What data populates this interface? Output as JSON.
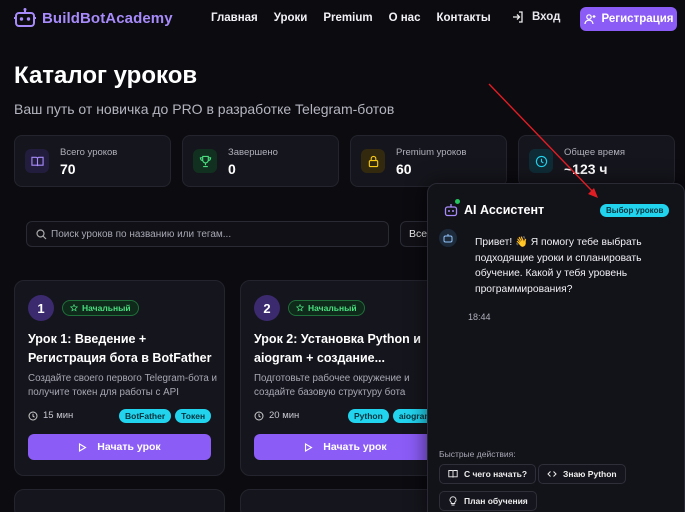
{
  "brand": {
    "name": "BuildBotAcademy",
    "accent": "#8b5cf6"
  },
  "nav": {
    "items": [
      "Главная",
      "Уроки",
      "Premium",
      "О нас",
      "Контакты"
    ],
    "login": "Вход",
    "register": "Регистрация"
  },
  "hero": {
    "title": "Каталог уроков",
    "subtitle": "Ваш путь от новичка до PRO в разработке Telegram-ботов"
  },
  "stats": [
    {
      "label": "Всего уроков",
      "value": "70",
      "icon": "book-icon"
    },
    {
      "label": "Завершено",
      "value": "0",
      "icon": "trophy-icon"
    },
    {
      "label": "Premium уроков",
      "value": "60",
      "icon": "lock-icon"
    },
    {
      "label": "Общее время",
      "value": "~123 ч",
      "icon": "clock-icon"
    }
  ],
  "search": {
    "placeholder": "Поиск уроков по названию или тегам...",
    "filter_value": "Все"
  },
  "lessons": [
    {
      "number": "1",
      "level": "Начальный",
      "title": "Урок 1: Введение + Регистрация бота в BotFather",
      "description": "Создайте своего первого Telegram-бота и получите токен для работы с API",
      "duration": "15 мин",
      "tags": [
        "BotFather",
        "Токен"
      ],
      "cta": "Начать урок"
    },
    {
      "number": "2",
      "level": "Начальный",
      "title": "Урок 2: Установка Python и aiogram + создание...",
      "description": "Подготовьте рабочее окружение и создайте базовую структуру бота",
      "duration": "20 мин",
      "tags": [
        "Python",
        "aiogram"
      ],
      "cta": "Начать урок"
    }
  ],
  "assistant": {
    "title": "AI Ассистент",
    "pill": "Выбор уроков",
    "message": "Привет! 👋 Я помогу тебе выбрать подходящие уроки и спланировать обучение. Какой у тебя уровень программирования?",
    "time": "18:44",
    "quick_label": "Быстрые действия:",
    "quick_actions": [
      "С чего начать?",
      "Знаю Python",
      "План обучения"
    ]
  }
}
